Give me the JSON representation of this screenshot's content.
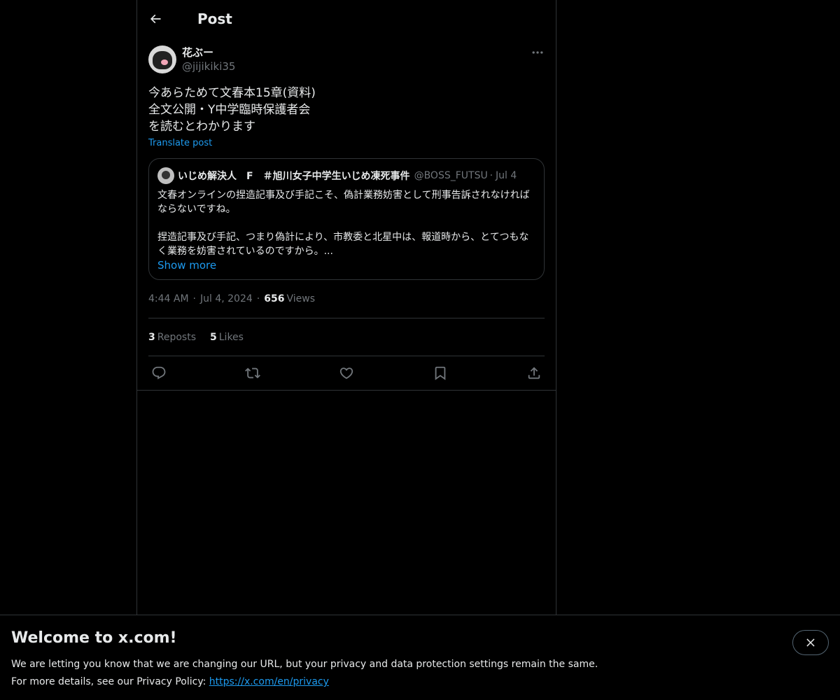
{
  "header": {
    "title": "Post"
  },
  "post": {
    "author": {
      "display_name": "花ぶー",
      "handle": "@jijikiki35"
    },
    "text": "今あらためて文春本15章(資料)\n全文公開・Y中学臨時保護者会\nを読むとわかります",
    "translate_label": "Translate post",
    "quote": {
      "display_name": "いじめ解決人　F　＃旭川女子中学生いじめ凍死事件",
      "handle": "@BOSS_FUTSU",
      "date": "Jul 4",
      "text": "文春オンラインの捏造記事及び手記こそ、偽計業務妨害として刑事告訴されなければならないですね。\n\n捏造記事及び手記、つまり偽計により、市教委と北星中は、報道時から、とてつもなく業務を妨害されているのですから。...",
      "show_more": "Show more"
    },
    "time": "4:44 AM",
    "date": "Jul 4, 2024",
    "views_count": "656",
    "views_label": "Views",
    "reposts_count": "3",
    "reposts_label": "Reposts",
    "likes_count": "5",
    "likes_label": "Likes"
  },
  "icons": [
    "back-arrow-icon",
    "more-icon",
    "reply-icon",
    "repost-icon",
    "like-icon",
    "bookmark-icon",
    "share-icon",
    "close-icon"
  ],
  "colors": {
    "background": "#000000",
    "text": "#e7e9ea",
    "muted": "#71767b",
    "accent": "#1d9bf0",
    "border": "#2f3336"
  },
  "banner": {
    "title": "Welcome to x.com!",
    "line1": "We are letting you know that we are changing our URL, but your privacy and data protection settings remain the same.",
    "line2_prefix": "For more details, see our Privacy Policy: ",
    "link": "https://x.com/en/privacy"
  }
}
